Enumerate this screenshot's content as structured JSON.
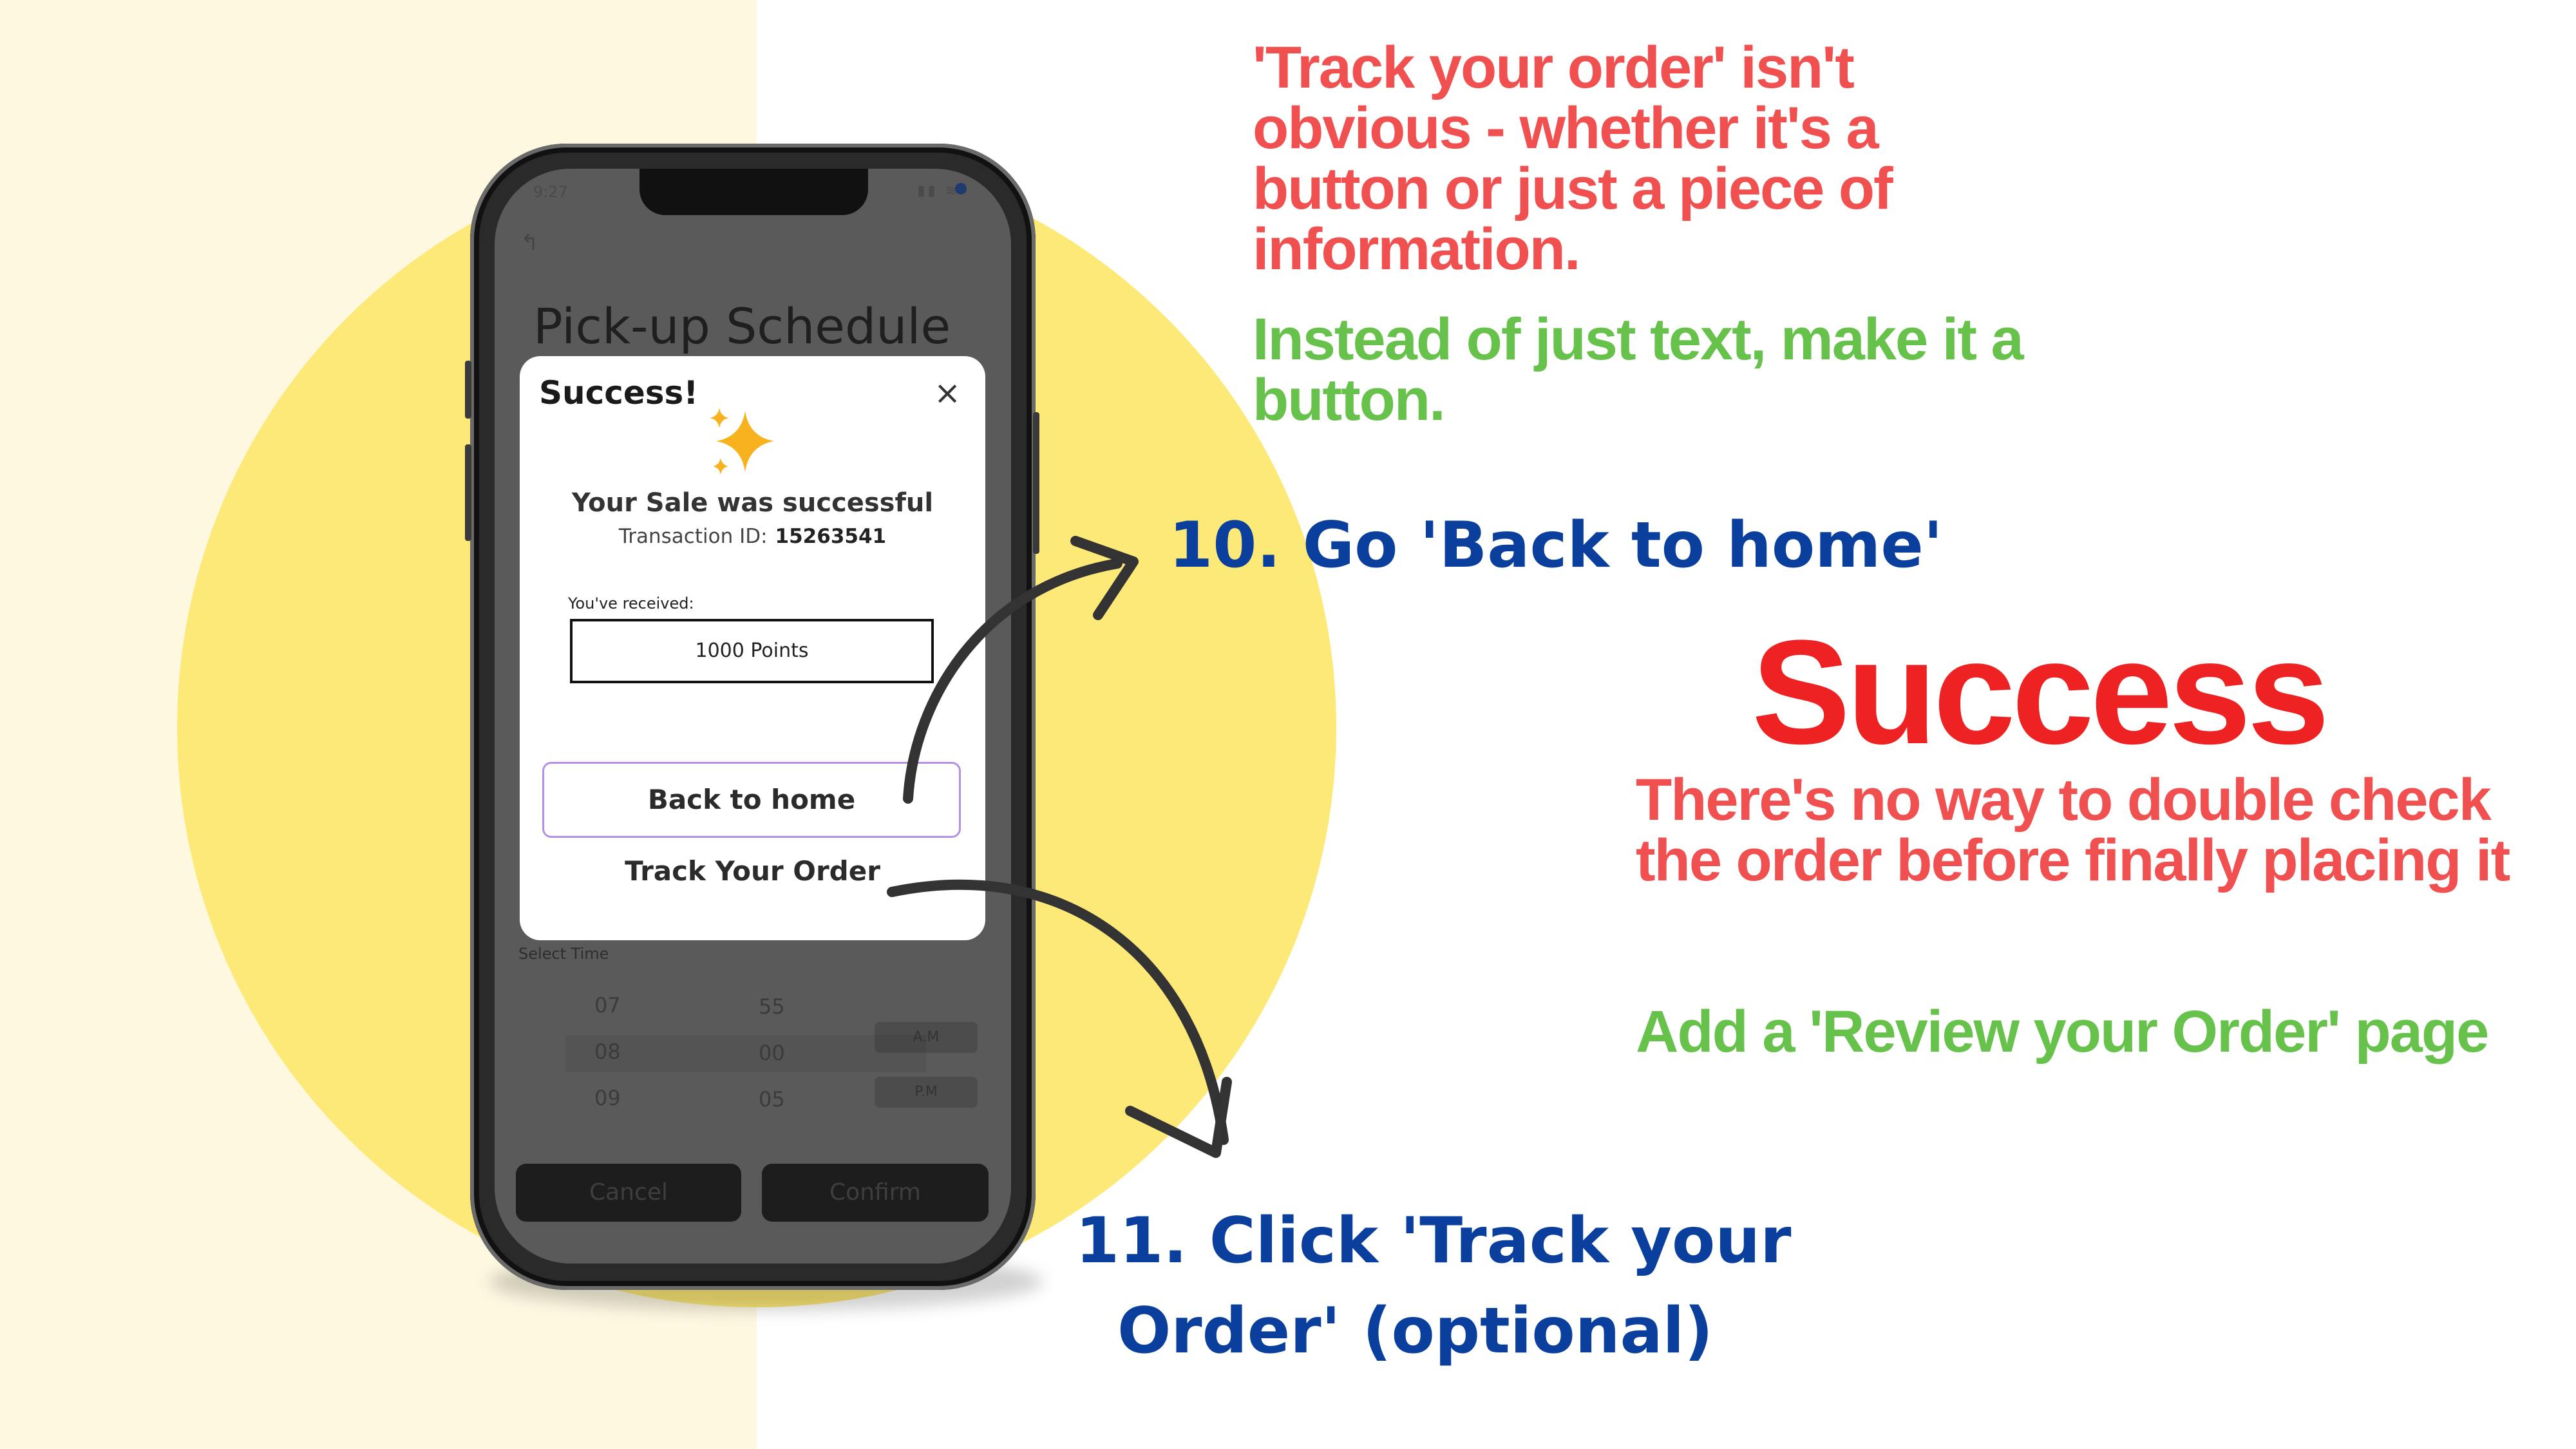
{
  "annotations": {
    "note1_red": "'Track your order' isn't obvious - whether it's a button or just a piece of information.",
    "note1_green": "Instead of just text, make it a button.",
    "step10": "10. Go 'Back to home'",
    "success_heading": "Success",
    "note2_red": "There's no way to double check the order before finally placing it",
    "note2_green": "Add a 'Review your Order' page",
    "step11_line1": "11. Click 'Track your",
    "step11_line2": "Order' (optional)"
  },
  "phone": {
    "status_time": "9:27",
    "status_icons": "▮▮ ≋",
    "screen_title": "Pick-up Schedule",
    "select_time_label": "Select Time",
    "hours": [
      "07",
      "08",
      "09"
    ],
    "minutes": [
      "55",
      "00",
      "05"
    ],
    "am": "A.M",
    "pm": "P.M",
    "cancel": "Cancel",
    "confirm": "Confirm"
  },
  "modal": {
    "title": "Success!",
    "close": "×",
    "sale_message": "Your Sale was successful",
    "transaction_label": "Transaction ID:",
    "transaction_id": "15263541",
    "received_label": "You've received:",
    "points": "1000 Points",
    "back_home": "Back to home",
    "track_order": "Track Your Order"
  },
  "colors": {
    "left_panel": "#fef8e1",
    "circle": "#fde978",
    "red_note": "#f05050",
    "green_note": "#66c24a",
    "blue_step": "#0b3f9e",
    "success_red": "#ee2222"
  }
}
